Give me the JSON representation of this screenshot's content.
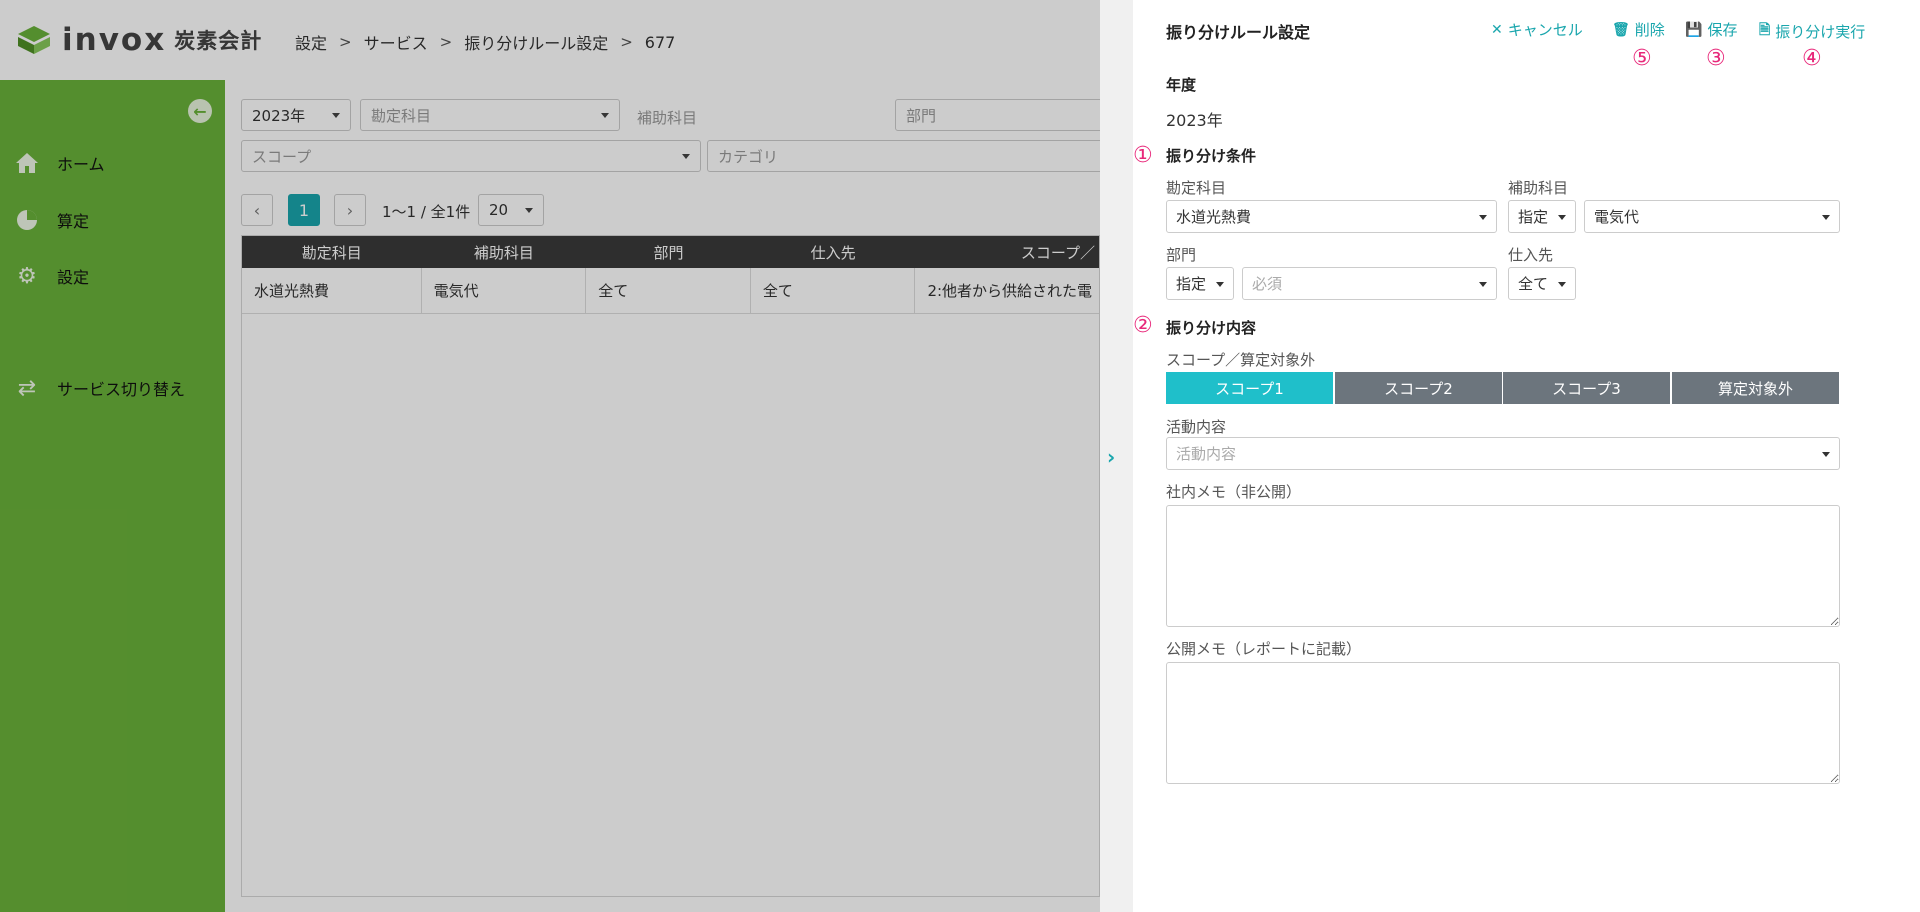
{
  "header": {
    "logo_word": "invox",
    "logo_sub": "炭素会計",
    "breadcrumb": [
      "設定",
      "サービス",
      "振り分けルール設定",
      "677"
    ]
  },
  "sidebar": {
    "items": [
      {
        "label": "ホーム",
        "icon": "home-icon"
      },
      {
        "label": "算定",
        "icon": "pie-chart-icon"
      },
      {
        "label": "設定",
        "icon": "gear-icon"
      },
      {
        "label": "サービス切り替え",
        "icon": "switch-icon"
      }
    ]
  },
  "filters": {
    "year": "2023年",
    "account": "勘定科目",
    "subaccount": "補助科目",
    "department": "部門",
    "scope": "スコープ",
    "category": "カテゴリ"
  },
  "pagination": {
    "current_page": "1",
    "range_text": "1〜1 / 全1件",
    "page_size": "20"
  },
  "table": {
    "headers": [
      "勘定科目",
      "補助科目",
      "部門",
      "仕入先",
      "スコープ／"
    ],
    "rows": [
      [
        "水道光熱費",
        "電気代",
        "全て",
        "全て",
        "2:他者から供給された電"
      ]
    ]
  },
  "panel": {
    "title": "振り分けルール設定",
    "actions": {
      "cancel": "キャンセル",
      "delete": "削除",
      "save": "保存",
      "execute": "振り分け実行"
    },
    "markers": {
      "delete": "⑤",
      "save": "③",
      "execute": "④",
      "conditions": "①",
      "content": "②"
    },
    "year_label": "年度",
    "year_value": "2023年",
    "conditions": {
      "heading": "振り分け条件",
      "account_label": "勘定科目",
      "account_value": "水道光熱費",
      "subaccount_label": "補助科目",
      "subaccount_mode": "指定",
      "subaccount_value": "電気代",
      "department_label": "部門",
      "department_mode": "指定",
      "department_placeholder": "必須",
      "supplier_label": "仕入先",
      "supplier_value": "全て"
    },
    "content": {
      "heading": "振り分け内容",
      "scope_label": "スコープ／算定対象外",
      "scope_options": [
        "スコープ1",
        "スコープ2",
        "スコープ3",
        "算定対象外"
      ],
      "scope_selected": "スコープ1",
      "activity_label": "活動内容",
      "activity_placeholder": "活動内容",
      "internal_memo_label": "社内メモ（非公開）",
      "public_memo_label": "公開メモ（レポートに記載）"
    }
  },
  "colors": {
    "sidebar_green": "#6ab23a",
    "accent_teal": "#1aa6ad",
    "scope_active": "#1fbfca",
    "scope_inactive": "#6c757d",
    "marker_pink": "#e8287a"
  }
}
